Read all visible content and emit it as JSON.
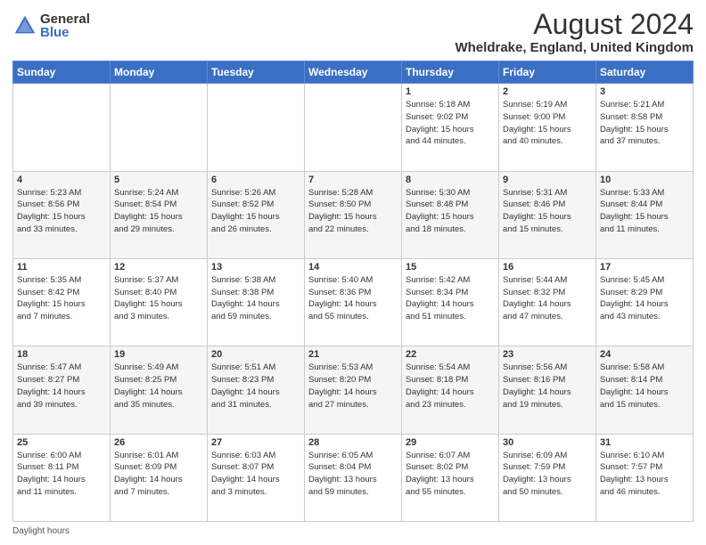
{
  "header": {
    "logo_general": "General",
    "logo_blue": "Blue",
    "month_title": "August 2024",
    "location": "Wheldrake, England, United Kingdom"
  },
  "weekdays": [
    "Sunday",
    "Monday",
    "Tuesday",
    "Wednesday",
    "Thursday",
    "Friday",
    "Saturday"
  ],
  "weeks": [
    [
      {
        "day": "",
        "info": ""
      },
      {
        "day": "",
        "info": ""
      },
      {
        "day": "",
        "info": ""
      },
      {
        "day": "",
        "info": ""
      },
      {
        "day": "1",
        "info": "Sunrise: 5:18 AM\nSunset: 9:02 PM\nDaylight: 15 hours\nand 44 minutes."
      },
      {
        "day": "2",
        "info": "Sunrise: 5:19 AM\nSunset: 9:00 PM\nDaylight: 15 hours\nand 40 minutes."
      },
      {
        "day": "3",
        "info": "Sunrise: 5:21 AM\nSunset: 8:58 PM\nDaylight: 15 hours\nand 37 minutes."
      }
    ],
    [
      {
        "day": "4",
        "info": "Sunrise: 5:23 AM\nSunset: 8:56 PM\nDaylight: 15 hours\nand 33 minutes."
      },
      {
        "day": "5",
        "info": "Sunrise: 5:24 AM\nSunset: 8:54 PM\nDaylight: 15 hours\nand 29 minutes."
      },
      {
        "day": "6",
        "info": "Sunrise: 5:26 AM\nSunset: 8:52 PM\nDaylight: 15 hours\nand 26 minutes."
      },
      {
        "day": "7",
        "info": "Sunrise: 5:28 AM\nSunset: 8:50 PM\nDaylight: 15 hours\nand 22 minutes."
      },
      {
        "day": "8",
        "info": "Sunrise: 5:30 AM\nSunset: 8:48 PM\nDaylight: 15 hours\nand 18 minutes."
      },
      {
        "day": "9",
        "info": "Sunrise: 5:31 AM\nSunset: 8:46 PM\nDaylight: 15 hours\nand 15 minutes."
      },
      {
        "day": "10",
        "info": "Sunrise: 5:33 AM\nSunset: 8:44 PM\nDaylight: 15 hours\nand 11 minutes."
      }
    ],
    [
      {
        "day": "11",
        "info": "Sunrise: 5:35 AM\nSunset: 8:42 PM\nDaylight: 15 hours\nand 7 minutes."
      },
      {
        "day": "12",
        "info": "Sunrise: 5:37 AM\nSunset: 8:40 PM\nDaylight: 15 hours\nand 3 minutes."
      },
      {
        "day": "13",
        "info": "Sunrise: 5:38 AM\nSunset: 8:38 PM\nDaylight: 14 hours\nand 59 minutes."
      },
      {
        "day": "14",
        "info": "Sunrise: 5:40 AM\nSunset: 8:36 PM\nDaylight: 14 hours\nand 55 minutes."
      },
      {
        "day": "15",
        "info": "Sunrise: 5:42 AM\nSunset: 8:34 PM\nDaylight: 14 hours\nand 51 minutes."
      },
      {
        "day": "16",
        "info": "Sunrise: 5:44 AM\nSunset: 8:32 PM\nDaylight: 14 hours\nand 47 minutes."
      },
      {
        "day": "17",
        "info": "Sunrise: 5:45 AM\nSunset: 8:29 PM\nDaylight: 14 hours\nand 43 minutes."
      }
    ],
    [
      {
        "day": "18",
        "info": "Sunrise: 5:47 AM\nSunset: 8:27 PM\nDaylight: 14 hours\nand 39 minutes."
      },
      {
        "day": "19",
        "info": "Sunrise: 5:49 AM\nSunset: 8:25 PM\nDaylight: 14 hours\nand 35 minutes."
      },
      {
        "day": "20",
        "info": "Sunrise: 5:51 AM\nSunset: 8:23 PM\nDaylight: 14 hours\nand 31 minutes."
      },
      {
        "day": "21",
        "info": "Sunrise: 5:53 AM\nSunset: 8:20 PM\nDaylight: 14 hours\nand 27 minutes."
      },
      {
        "day": "22",
        "info": "Sunrise: 5:54 AM\nSunset: 8:18 PM\nDaylight: 14 hours\nand 23 minutes."
      },
      {
        "day": "23",
        "info": "Sunrise: 5:56 AM\nSunset: 8:16 PM\nDaylight: 14 hours\nand 19 minutes."
      },
      {
        "day": "24",
        "info": "Sunrise: 5:58 AM\nSunset: 8:14 PM\nDaylight: 14 hours\nand 15 minutes."
      }
    ],
    [
      {
        "day": "25",
        "info": "Sunrise: 6:00 AM\nSunset: 8:11 PM\nDaylight: 14 hours\nand 11 minutes."
      },
      {
        "day": "26",
        "info": "Sunrise: 6:01 AM\nSunset: 8:09 PM\nDaylight: 14 hours\nand 7 minutes."
      },
      {
        "day": "27",
        "info": "Sunrise: 6:03 AM\nSunset: 8:07 PM\nDaylight: 14 hours\nand 3 minutes."
      },
      {
        "day": "28",
        "info": "Sunrise: 6:05 AM\nSunset: 8:04 PM\nDaylight: 13 hours\nand 59 minutes."
      },
      {
        "day": "29",
        "info": "Sunrise: 6:07 AM\nSunset: 8:02 PM\nDaylight: 13 hours\nand 55 minutes."
      },
      {
        "day": "30",
        "info": "Sunrise: 6:09 AM\nSunset: 7:59 PM\nDaylight: 13 hours\nand 50 minutes."
      },
      {
        "day": "31",
        "info": "Sunrise: 6:10 AM\nSunset: 7:57 PM\nDaylight: 13 hours\nand 46 minutes."
      }
    ]
  ],
  "footer": {
    "daylight_label": "Daylight hours"
  }
}
